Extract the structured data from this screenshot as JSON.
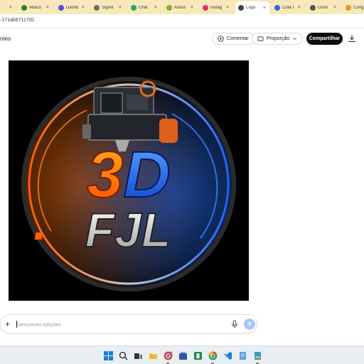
{
  "browser": {
    "tabs": [
      {
        "label": "",
        "color": "#6a6a6a"
      },
      {
        "label": "Abaco",
        "color": "#2e7d32"
      },
      {
        "label": "Dashb",
        "color": "#5b4bd6"
      },
      {
        "label": "Signifi",
        "color": "#6d6d6d"
      },
      {
        "label": "Chat",
        "color": "#2aa46b"
      },
      {
        "label": "Acess",
        "color": "#7fb23b"
      },
      {
        "label": "Instag",
        "color": "#e1306c"
      },
      {
        "label": "Logo",
        "color": "#444444"
      },
      {
        "label": "Criar I",
        "color": "#2a6ce0"
      },
      {
        "label": "Unno",
        "color": "#555555"
      },
      {
        "label": "Cong",
        "color": "#e29b2c"
      }
    ],
    "active_tab_index": 7,
    "url": "-171ab971c7d1"
  },
  "header": {
    "left_text": "ntes",
    "comment_label": "Comentar",
    "proportion_label": "Proporção",
    "share_label": "Compartilhar"
  },
  "image": {
    "logo_top": "3D",
    "logo_bottom": "FJL"
  },
  "prompt": {
    "placeholder": "Descrever edições"
  },
  "taskbar": {
    "apps": [
      "windows-start",
      "search",
      "task-view",
      "chrome-profile",
      "file-explorer",
      "store",
      "excel",
      "chrome",
      "vscode",
      "notepad",
      "extra-app"
    ]
  }
}
